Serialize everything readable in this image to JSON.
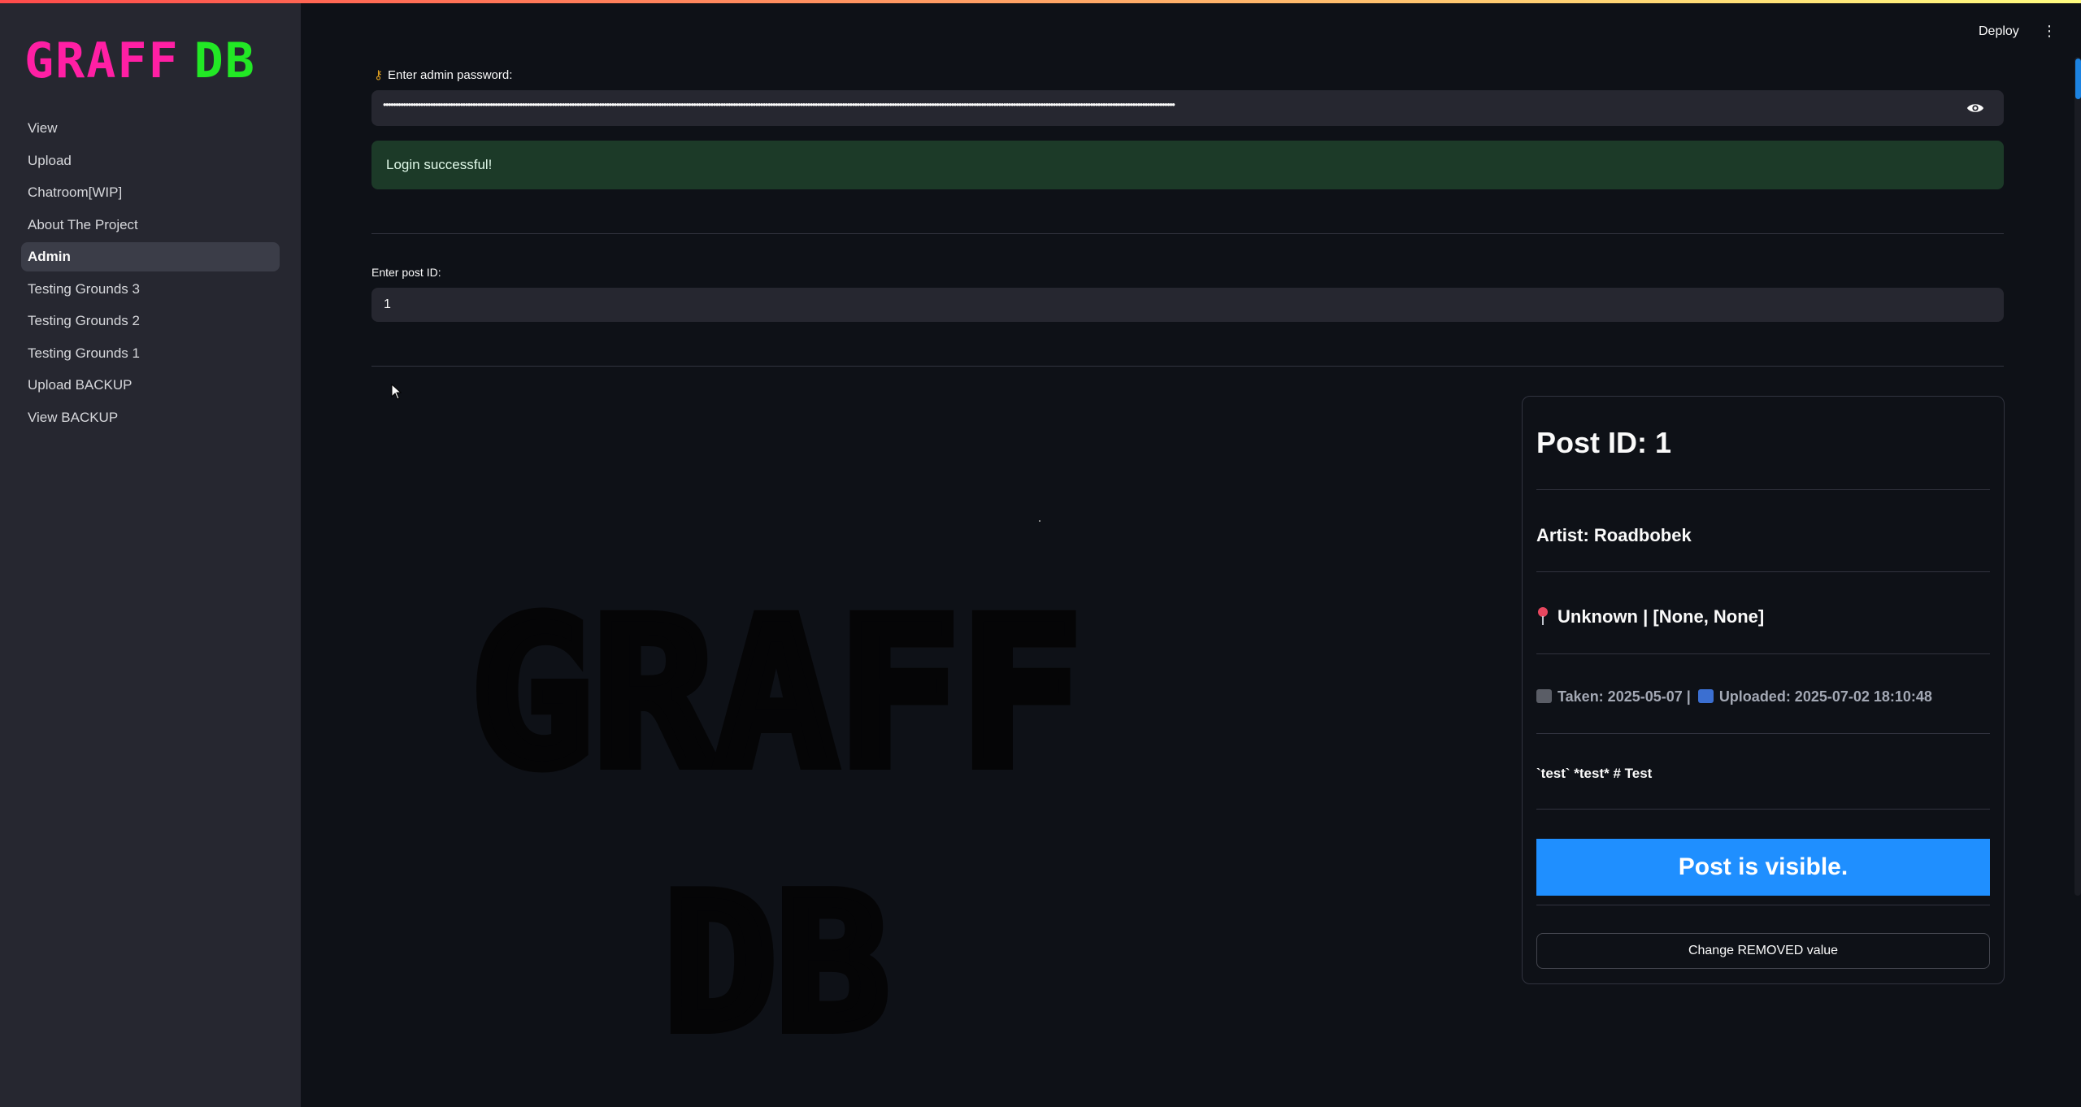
{
  "sidebar": {
    "logo": {
      "part1": "GRAFF",
      "part2": "DB"
    },
    "items": [
      {
        "label": "View"
      },
      {
        "label": "Upload"
      },
      {
        "label": "Chatroom[WIP]"
      },
      {
        "label": "About The Project"
      },
      {
        "label": "Admin",
        "active": true
      },
      {
        "label": "Testing Grounds 3"
      },
      {
        "label": "Testing Grounds 2"
      },
      {
        "label": "Testing Grounds 1"
      },
      {
        "label": "Upload BACKUP"
      },
      {
        "label": "View BACKUP"
      }
    ]
  },
  "header": {
    "deploy_label": "Deploy",
    "menu_icon": "kebab-menu-icon"
  },
  "main": {
    "password_label": "Enter admin password:",
    "password_value": "•••••••••••••••••••••••••••••••••••••••••••••••••••••••••••••••••••••••••••••••••••••••••••••••••••••••••••••••••••••••••••••••••••••••••••••••••••••••••••••••••••••••••••••••••••••••••••••••••••••••••••••••••••••••••••••••••••••••••••••••••••••••••••••••••••••••••••••••••••••••••••••••••••••••••••••••••••••••••••••••",
    "success_message": "Login successful!",
    "post_id_label": "Enter post ID:",
    "post_id_value": "1",
    "image_text": {
      "line1": "GRAFF",
      "line2": "DB"
    }
  },
  "post": {
    "title": "Post ID: 1",
    "artist": "Artist: Roadbobek",
    "location": "Unknown | [None, None]",
    "taken": "Taken: 2025-05-07 |",
    "uploaded": "Uploaded: 2025-07-02 18:10:48",
    "description": "`test` *test* # Test",
    "visible_status": "Post is visible.",
    "change_button": "Change REMOVED value"
  },
  "colors": {
    "background": "#0e1117",
    "sidebar": "#262730",
    "logo_pink": "#ff1fa4",
    "logo_green": "#22e825",
    "success_bg": "#1c3a28",
    "visible_button": "#1f8fff"
  }
}
